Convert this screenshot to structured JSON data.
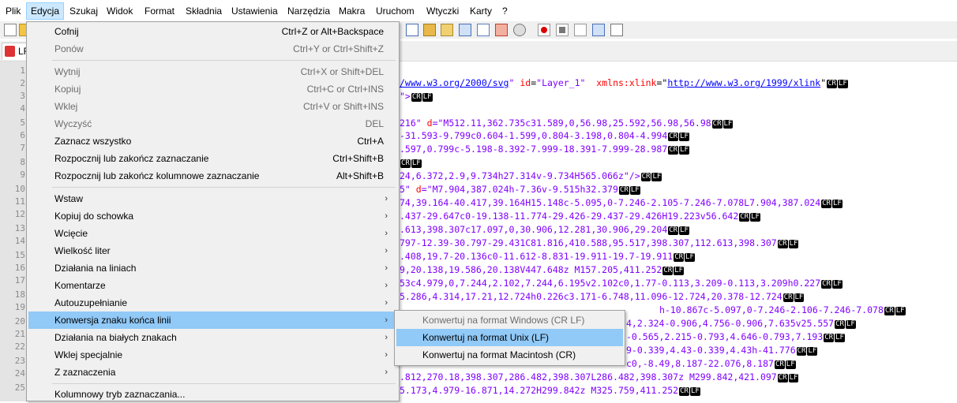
{
  "menubar": {
    "items": [
      "Plik",
      "Edycja",
      "Szukaj",
      "Widok",
      "Format",
      "Składnia",
      "Ustawienia",
      "Narzędzia",
      "Makra",
      "Uruchom",
      "Wtyczki",
      "Karty",
      "?"
    ]
  },
  "tabs": [
    {
      "label": "LF"
    }
  ],
  "line_numbers": [
    "1",
    "2",
    "3",
    "4",
    "5",
    "6",
    "7",
    "8",
    "9",
    "10",
    "11",
    "12",
    "13",
    "14",
    "15",
    "16",
    "17",
    "18",
    "19",
    "20",
    "21",
    "22",
    "23",
    "24",
    "25"
  ],
  "editor": {
    "eol_cr": "CR",
    "eol_lf": "LF",
    "line2": {
      "u1": "/www.w3.org/2000/svg",
      "k1": "\" ",
      "a1": "id",
      "k2": "=",
      "s1": "\"Layer_1\"",
      "a2": "  xmlns:xlink",
      "k3": "=\"",
      "u2": "http://www.w3.org/1999/xlink",
      "k4": "\""
    },
    "line3": {
      "k1": "\">"
    },
    "line5": {
      "s1": "216\" ",
      "a1": "d",
      "s2": "=\"M512.11,362.735c31.589,0,56.98,25.592,56.98,56.98"
    },
    "line6": {
      "s1": "-31.593-9.799c0.604-1.599,0.804-3.198,0.804-4.994"
    },
    "line7": {
      "s1": ".597,0.799c-5.198-8.392-7.999-18.391-7.999-28.987"
    },
    "line9": {
      "s1": "24,6.372,2.9,9.734h27.314v-9.734H565.066z\"/>"
    },
    "line10": {
      "s1": "5\" ",
      "a1": "d",
      "s2": "=\"M7.904,387.024h-7.36v-9.515h32.379"
    },
    "line11": {
      "s1": "74,39.164-40.417,39.164H15.148c-5.095,0-7.246-2.105-7.246-7.078L7.904,387.024"
    },
    "line12": {
      "s1": ".437-29.647c0-19.138-11.774-29.426-29.437-29.426H19.223v56.642"
    },
    "line13": {
      "s1": ".613,398.307c17.097,0,30.906,12.281,30.906,29.204"
    },
    "line14": {
      "s1": "797-12.39-30.797-29.431C81.816,410.588,95.517,398.307,112.613,398.307"
    },
    "line15": {
      "s1": ".408,19.7-20.136c0-11.612-8.831-19.911-19.7-19.911"
    },
    "line16": {
      "s1": "9,20.138,19.586,20.138V447.648z M157.205,411.252"
    },
    "line17": {
      "s1": "53c4.979,0,7.244,2.102,7.244,6.195v2.102c0,1.77-0.113,3.209-0.113,3.209h0.227"
    },
    "line18": {
      "s1": "5.286,4.314,17.21,12.724h0.226c3.171-6.748,11.096-12.724,20.378-12.724"
    },
    "line19": {
      "s1": "h-10.867c-5.097,0-7.246-2.106-7.246-7.078"
    },
    "line20": {
      "s1": "4,2.324-0.906,4.756-0.906,7.635v25.557"
    },
    "line21": {
      "s1": "-0.565,2.215-0.793,4.646-0.793,7.193"
    },
    "line22": {
      "s1": "9-0.339,4.43-0.339,4.43h-41.776"
    },
    "line23": {
      "s1": "c0,-8.49,8.187-22.076,8.187"
    },
    "line24": {
      "s1": ".812,270.18,398.307,286.482,398.307L286.482,398.307z M299.842,421.097"
    },
    "line25": {
      "s1": "5.173,4.979-16.871,14.272H299.842z M325.759,411.252"
    }
  },
  "edit_menu": {
    "items": [
      {
        "label": "Cofnij",
        "shortcut": "Ctrl+Z or Alt+Backspace"
      },
      {
        "label": "Ponów",
        "shortcut": "Ctrl+Y or Ctrl+Shift+Z"
      },
      {
        "label": "Wytnij",
        "shortcut": "Ctrl+X or Shift+DEL"
      },
      {
        "label": "Kopiuj",
        "shortcut": "Ctrl+C or Ctrl+INS"
      },
      {
        "label": "Wklej",
        "shortcut": "Ctrl+V or Shift+INS"
      },
      {
        "label": "Wyczyść",
        "shortcut": "DEL"
      },
      {
        "label": "Zaznacz wszystko",
        "shortcut": "Ctrl+A"
      },
      {
        "label": "Rozpocznij lub zakończ zaznaczanie",
        "shortcut": "Ctrl+Shift+B"
      },
      {
        "label": "Rozpocznij lub zakończ kolumnowe zaznaczanie",
        "shortcut": "Alt+Shift+B"
      },
      {
        "label": "Wstaw"
      },
      {
        "label": "Kopiuj do schowka"
      },
      {
        "label": "Wcięcie"
      },
      {
        "label": "Wielkość liter"
      },
      {
        "label": "Działania na liniach"
      },
      {
        "label": "Komentarze"
      },
      {
        "label": "Autouzupełnianie"
      },
      {
        "label": "Konwersja znaku końca linii"
      },
      {
        "label": "Działania na białych znakach"
      },
      {
        "label": "Wklej specjalnie"
      },
      {
        "label": "Z zaznaczenia"
      },
      {
        "label": "Kolumnowy tryb zaznaczania..."
      }
    ],
    "arrow": "›"
  },
  "eol_submenu": {
    "items": [
      {
        "label": "Konwertuj na format Windows (CR LF)"
      },
      {
        "label": "Konwertuj na format Unix (LF)"
      },
      {
        "label": "Konwertuj na format Macintosh (CR)"
      }
    ]
  },
  "colors": {
    "menu_highlight": "#91c9f7",
    "string": "#8000ff",
    "attribute": "#ff0000",
    "url": "#0000ff"
  }
}
